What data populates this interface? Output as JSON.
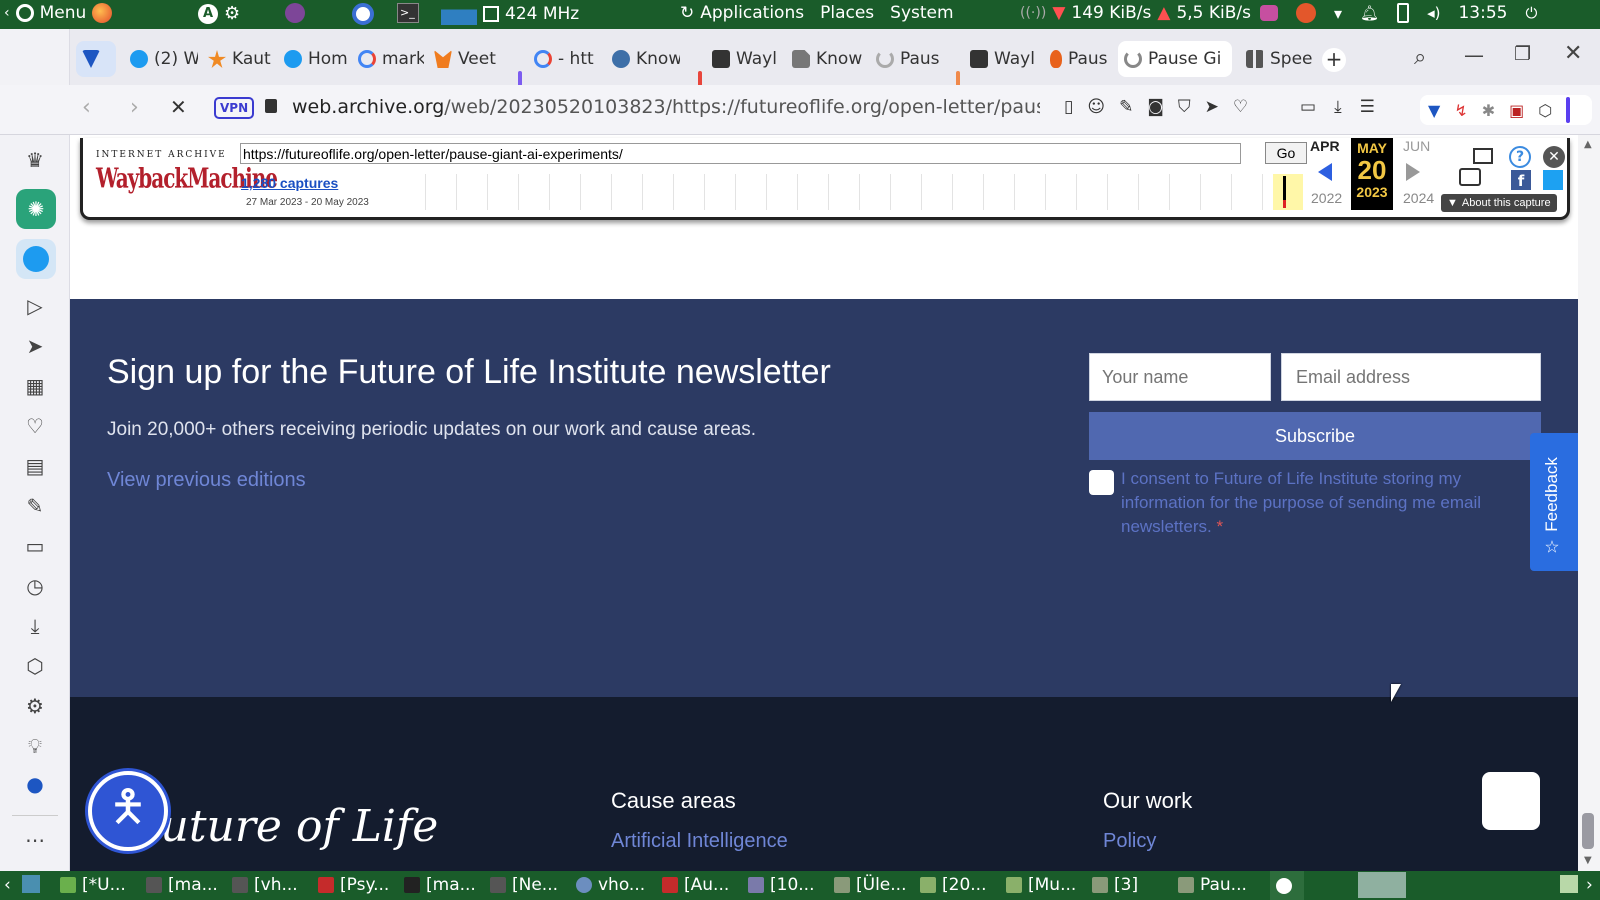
{
  "system_panel": {
    "menu_label": "Menu",
    "cpu_freq": "424 MHz",
    "applications": "Applications",
    "places": "Places",
    "system": "System",
    "net_down": "149 KiB/s",
    "net_up": "5,5 KiB/s",
    "clock": "13:55"
  },
  "tabs": [
    {
      "label": "",
      "icon": "tab-favicon"
    },
    {
      "label": "(2) W",
      "icon": "twitter-icon"
    },
    {
      "label": "Kaut",
      "icon": "star-icon"
    },
    {
      "label": "Hom",
      "icon": "twitter-icon"
    },
    {
      "label": "mark",
      "icon": "google-icon"
    },
    {
      "label": "Veet",
      "icon": "fox-icon"
    },
    {
      "label": "- htt",
      "icon": "google-icon"
    },
    {
      "label": "Know",
      "icon": "wordpress-icon"
    },
    {
      "label": "Wayl",
      "icon": "archive-icon"
    },
    {
      "label": "Know",
      "icon": "document-icon"
    },
    {
      "label": "Paus",
      "icon": "loading-icon"
    },
    {
      "label": "Wayl",
      "icon": "archive-icon"
    },
    {
      "label": "Paus",
      "icon": "flame-icon"
    },
    {
      "label": "Pause Gi",
      "icon": "loading-icon"
    },
    {
      "label": "Spee",
      "icon": "grid-icon"
    }
  ],
  "address_bar": {
    "vpn_label": "VPN",
    "url_host": "web.archive.org",
    "url_path": "/web/20230520103823/https://futureoflife.org/open-letter/pause"
  },
  "wayback": {
    "logo_top": "INTERNET ARCHIVE",
    "logo_main": "WaybackMachine",
    "url_value": "https://futureoflife.org/open-letter/pause-giant-ai-experiments/",
    "go_label": "Go",
    "captures_link": "1,280 captures",
    "date_range": "27 Mar 2023 - 20 May 2023",
    "month_prev": "APR",
    "month_cur": "MAY",
    "month_next": "JUN",
    "day": "20",
    "year_prev": "2022",
    "year_cur": "2023",
    "year_next": "2024",
    "about_label": "About this capture"
  },
  "newsletter": {
    "title": "Sign up for the Future of Life Institute newsletter",
    "subtitle": "Join 20,000+ others receiving periodic updates on our work and cause areas.",
    "previous_link": "View previous editions",
    "name_placeholder": "Your name",
    "email_placeholder": "Email address",
    "subscribe_label": "Subscribe",
    "consent_text": "I consent to Future of Life Institute storing my information for the purpose of sending me email newsletters.",
    "required_mark": "*",
    "feedback_label": "Feedback"
  },
  "footer": {
    "logo_text": "Future of Life",
    "cause_areas_heading": "Cause areas",
    "cause_link": "Artificial Intelligence",
    "our_work_heading": "Our work",
    "work_link": "Policy"
  },
  "taskbar": {
    "items": [
      "[*U...",
      "[ma...",
      "[vh...",
      "[Psy...",
      "[ma...",
      "[Ne...",
      "vho...",
      "[Au...",
      "[10...",
      "[Üle...",
      "[20...",
      "[Mu...",
      "[3]",
      "Pau..."
    ]
  },
  "colors": {
    "panel_green": "#1a5c2a",
    "newsletter_bg": "#2c3a63",
    "footer_bg": "#141c2e",
    "subscribe_bg": "#5068b0",
    "link_blue": "#6f86d6",
    "feedback_bg": "#2a6de0"
  }
}
